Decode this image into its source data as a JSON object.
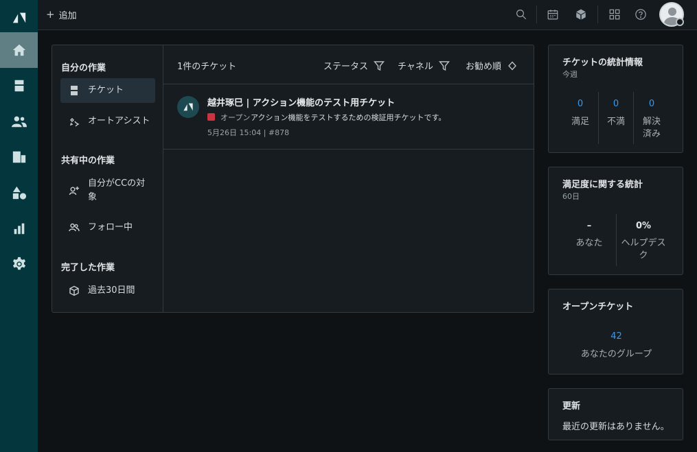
{
  "rail": {
    "items": [
      {
        "name": "home"
      },
      {
        "name": "tickets"
      },
      {
        "name": "customers"
      },
      {
        "name": "organizations"
      },
      {
        "name": "objects"
      },
      {
        "name": "reporting"
      },
      {
        "name": "settings"
      }
    ]
  },
  "topbar": {
    "add_label": "追加",
    "add_symbol": "+"
  },
  "views": {
    "my_work_heading": "自分の作業",
    "ticket_label": "チケット",
    "auto_assist_label": "オートアシスト",
    "shared_heading": "共有中の作業",
    "cc_label": "自分がCCの対象",
    "following_label": "フォロー中",
    "done_heading": "完了した作業",
    "past30_label": "過去30日間"
  },
  "ticket_list": {
    "count_label": "1件のチケット",
    "status_filter": "ステータス",
    "channel_filter": "チャネル",
    "sort_label": "お勧め順",
    "tickets": [
      {
        "title": "越井琢巳 | アクション機能のテスト用チケット",
        "status": "オープン",
        "status_color": "#cc3340",
        "description": "アクション機能をテストするための検証用チケットです。",
        "meta": "5月26日 15:04 | #878"
      }
    ]
  },
  "stats": {
    "title": "チケットの統計情報",
    "period": "今週",
    "items": [
      {
        "value": "0",
        "label_lines": [
          "満足"
        ]
      },
      {
        "value": "0",
        "label_lines": [
          "不満"
        ]
      },
      {
        "value": "0",
        "label_lines": [
          "解決",
          "済み"
        ]
      }
    ]
  },
  "satisfaction": {
    "title": "満足度に関する統計",
    "period": "60日",
    "items": [
      {
        "value": "–",
        "label_lines": [
          "あなた"
        ]
      },
      {
        "value": "0%",
        "label_lines": [
          "ヘルプデス",
          "ク"
        ]
      }
    ]
  },
  "open_tickets": {
    "title": "オープンチケット",
    "value": "42",
    "label": "あなたのグループ"
  },
  "updates": {
    "title": "更新",
    "text": "最近の更新はありません。"
  },
  "colors": {
    "rail": "#03363d",
    "accent_blue": "#3a98e8",
    "status_open": "#cc3340"
  }
}
